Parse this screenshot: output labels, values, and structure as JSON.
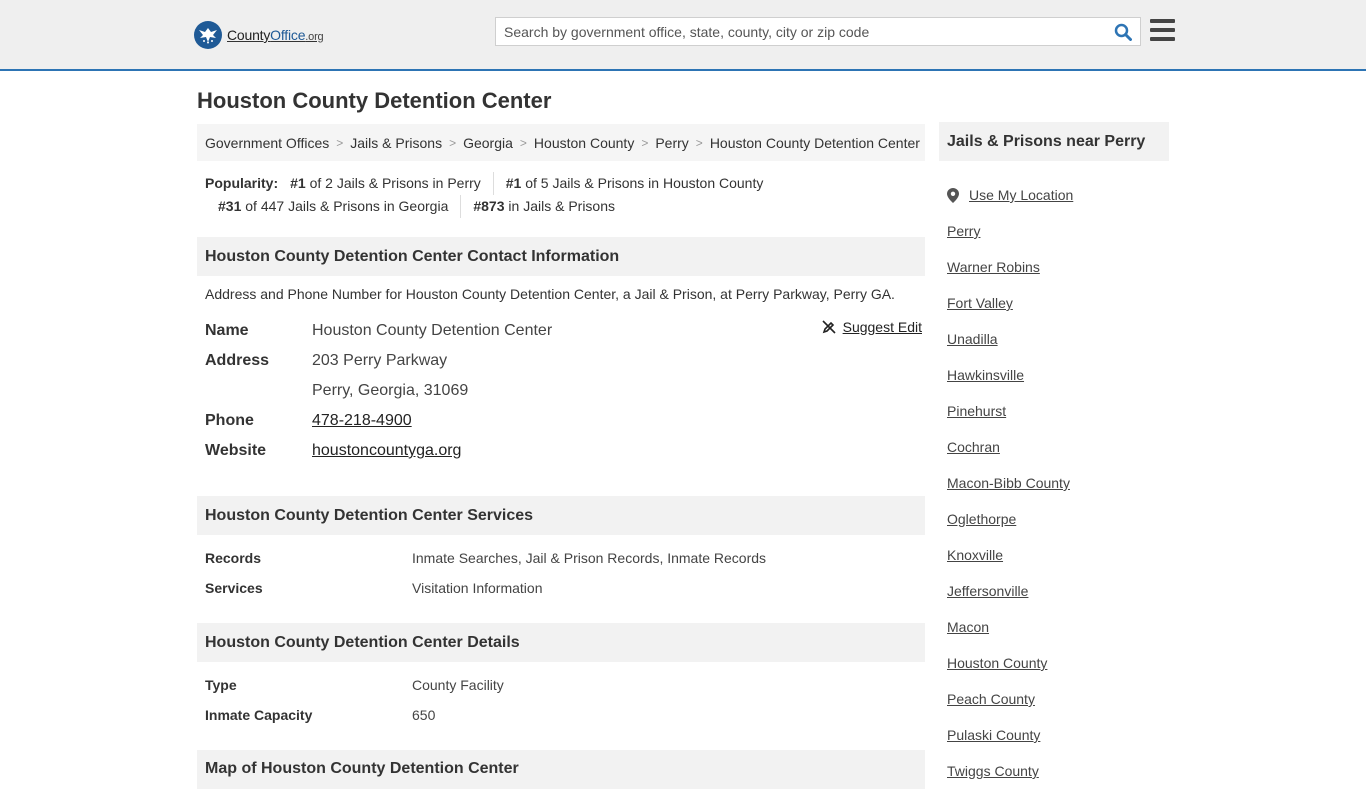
{
  "header": {
    "logo_brand": "County",
    "logo_bold": "Office",
    "logo_tld": ".org",
    "search_placeholder": "Search by government office, state, county, city or zip code"
  },
  "page_title": "Houston County Detention Center",
  "breadcrumb": [
    "Government Offices",
    "Jails & Prisons",
    "Georgia",
    "Houston County",
    "Perry",
    "Houston County Detention Center"
  ],
  "popularity": {
    "label": "Popularity:",
    "items": [
      {
        "rank": "#1",
        "text": "of 2 Jails & Prisons in Perry"
      },
      {
        "rank": "#1",
        "text": "of 5 Jails & Prisons in Houston County"
      },
      {
        "rank": "#31",
        "text": "of 447 Jails & Prisons in Georgia"
      },
      {
        "rank": "#873",
        "text": "in Jails & Prisons"
      }
    ]
  },
  "contact": {
    "heading": "Houston County Detention Center Contact Information",
    "description": "Address and Phone Number for Houston County Detention Center, a Jail & Prison, at Perry Parkway, Perry GA.",
    "suggest_edit": "Suggest Edit",
    "name_label": "Name",
    "name": "Houston County Detention Center",
    "address_label": "Address",
    "address_line1": "203 Perry Parkway",
    "address_line2": "Perry, Georgia, 31069",
    "phone_label": "Phone",
    "phone": "478-218-4900",
    "website_label": "Website",
    "website": "houstoncountyga.org"
  },
  "services": {
    "heading": "Houston County Detention Center Services",
    "rows": [
      {
        "key": "Records",
        "value": "Inmate Searches, Jail & Prison Records, Inmate Records"
      },
      {
        "key": "Services",
        "value": "Visitation Information"
      }
    ]
  },
  "details": {
    "heading": "Houston County Detention Center Details",
    "rows": [
      {
        "key": "Type",
        "value": "County Facility"
      },
      {
        "key": "Inmate Capacity",
        "value": "650"
      }
    ]
  },
  "map": {
    "heading": "Map of Houston County Detention Center"
  },
  "sidebar": {
    "heading": "Jails & Prisons near Perry",
    "use_location": "Use My Location",
    "places": [
      "Perry",
      "Warner Robins",
      "Fort Valley",
      "Unadilla",
      "Hawkinsville",
      "Pinehurst",
      "Cochran",
      "Macon-Bibb County",
      "Oglethorpe",
      "Knoxville",
      "Jeffersonville",
      "Macon",
      "Houston County",
      "Peach County",
      "Pulaski County",
      "Twiggs County"
    ]
  },
  "colors": {
    "accent": "#2d74b4",
    "logo": "#1f5a96"
  }
}
